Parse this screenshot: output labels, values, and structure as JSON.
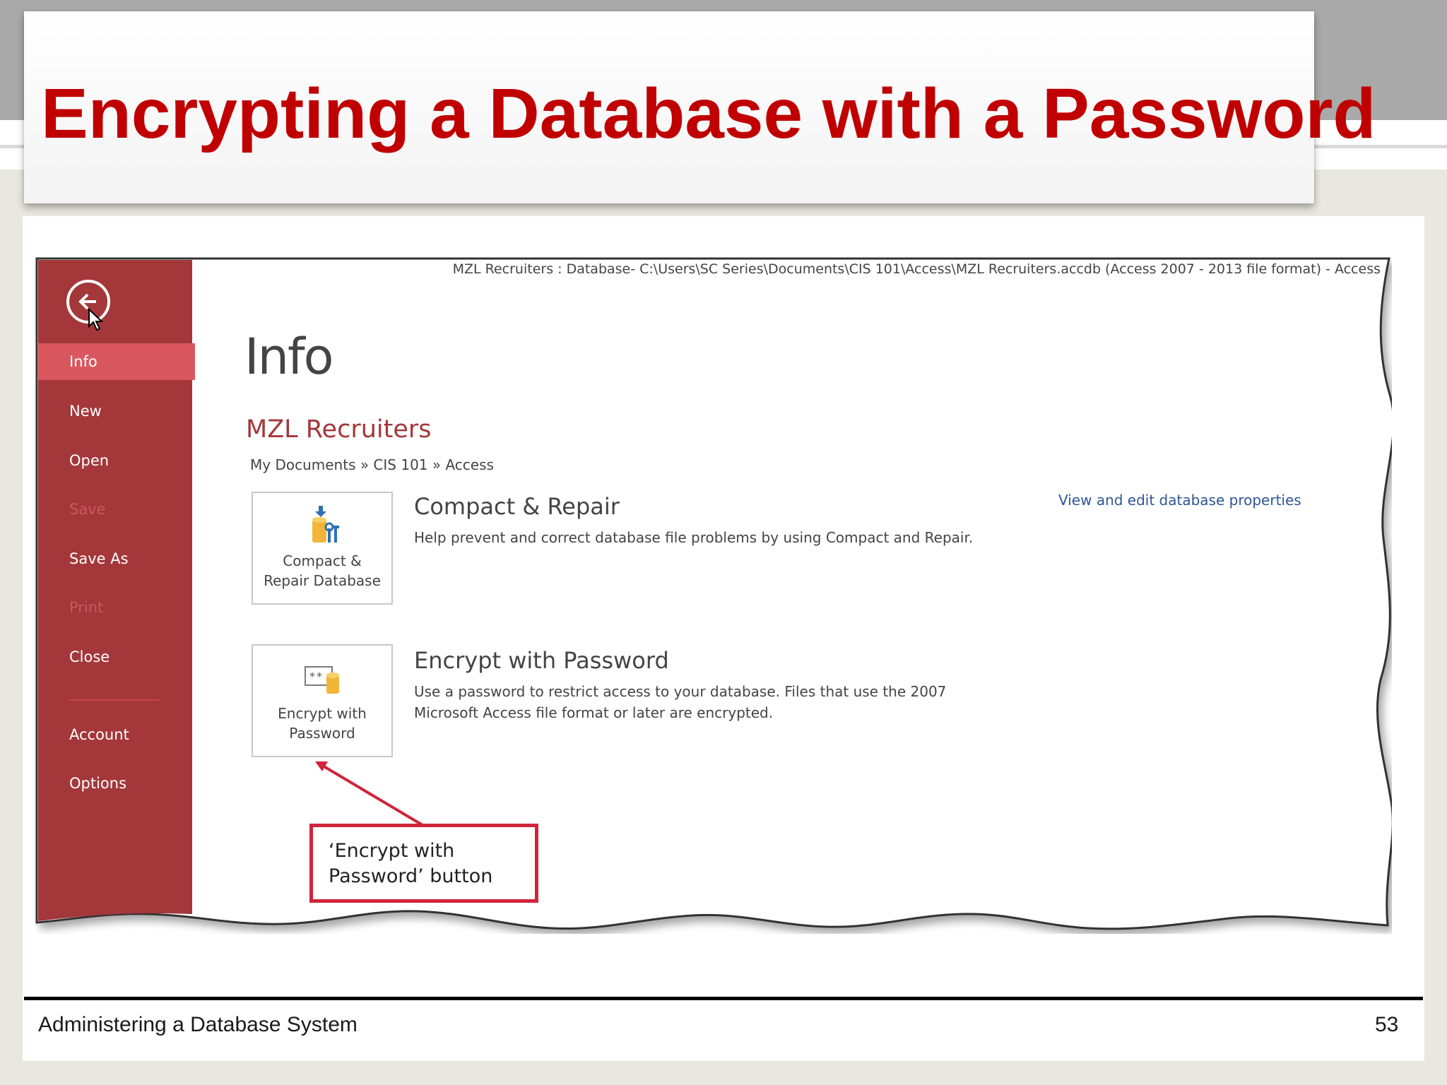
{
  "slide": {
    "title": "Encrypting a Database with a Password",
    "footer_text": "Administering a Database System",
    "page_number": "53"
  },
  "window": {
    "title": "MZL Recruiters : Database- C:\\Users\\SC Series\\Documents\\CIS 101\\Access\\MZL Recruiters.accdb (Access 2007 - 2013 file format) - Access"
  },
  "sidebar": {
    "back_icon": "back-arrow-icon",
    "items": [
      {
        "label": "Info",
        "state": "active"
      },
      {
        "label": "New",
        "state": "normal"
      },
      {
        "label": "Open",
        "state": "normal"
      },
      {
        "label": "Save",
        "state": "disabled"
      },
      {
        "label": "Save As",
        "state": "normal"
      },
      {
        "label": "Print",
        "state": "disabled"
      },
      {
        "label": "Close",
        "state": "normal"
      },
      {
        "label": "Account",
        "state": "normal"
      },
      {
        "label": "Options",
        "state": "normal"
      }
    ]
  },
  "main": {
    "heading": "Info",
    "database_name": "MZL Recruiters",
    "breadcrumb": "My Documents » CIS 101 » Access",
    "properties_link": "View and edit database properties",
    "sections": [
      {
        "button_line1": "Compact &",
        "button_line2": "Repair Database",
        "icon": "compact-repair-icon",
        "title": "Compact & Repair",
        "description": "Help prevent and correct database file problems by using Compact and Repair."
      },
      {
        "button_line1": "Encrypt with",
        "button_line2": "Password",
        "icon": "encrypt-password-icon",
        "title": "Encrypt with Password",
        "description_line1": "Use a password to restrict access to your database. Files that use the 2007",
        "description_line2": "Microsoft Access file format or later are encrypted."
      }
    ]
  },
  "callout": {
    "line1": "‘Encrypt with",
    "line2": "Password’ button"
  },
  "colors": {
    "title_red": "#c00000",
    "sidebar_red": "#a4373a",
    "active_item": "#d9575e",
    "callout_red": "#d0243b",
    "link_blue": "#2e5597"
  }
}
